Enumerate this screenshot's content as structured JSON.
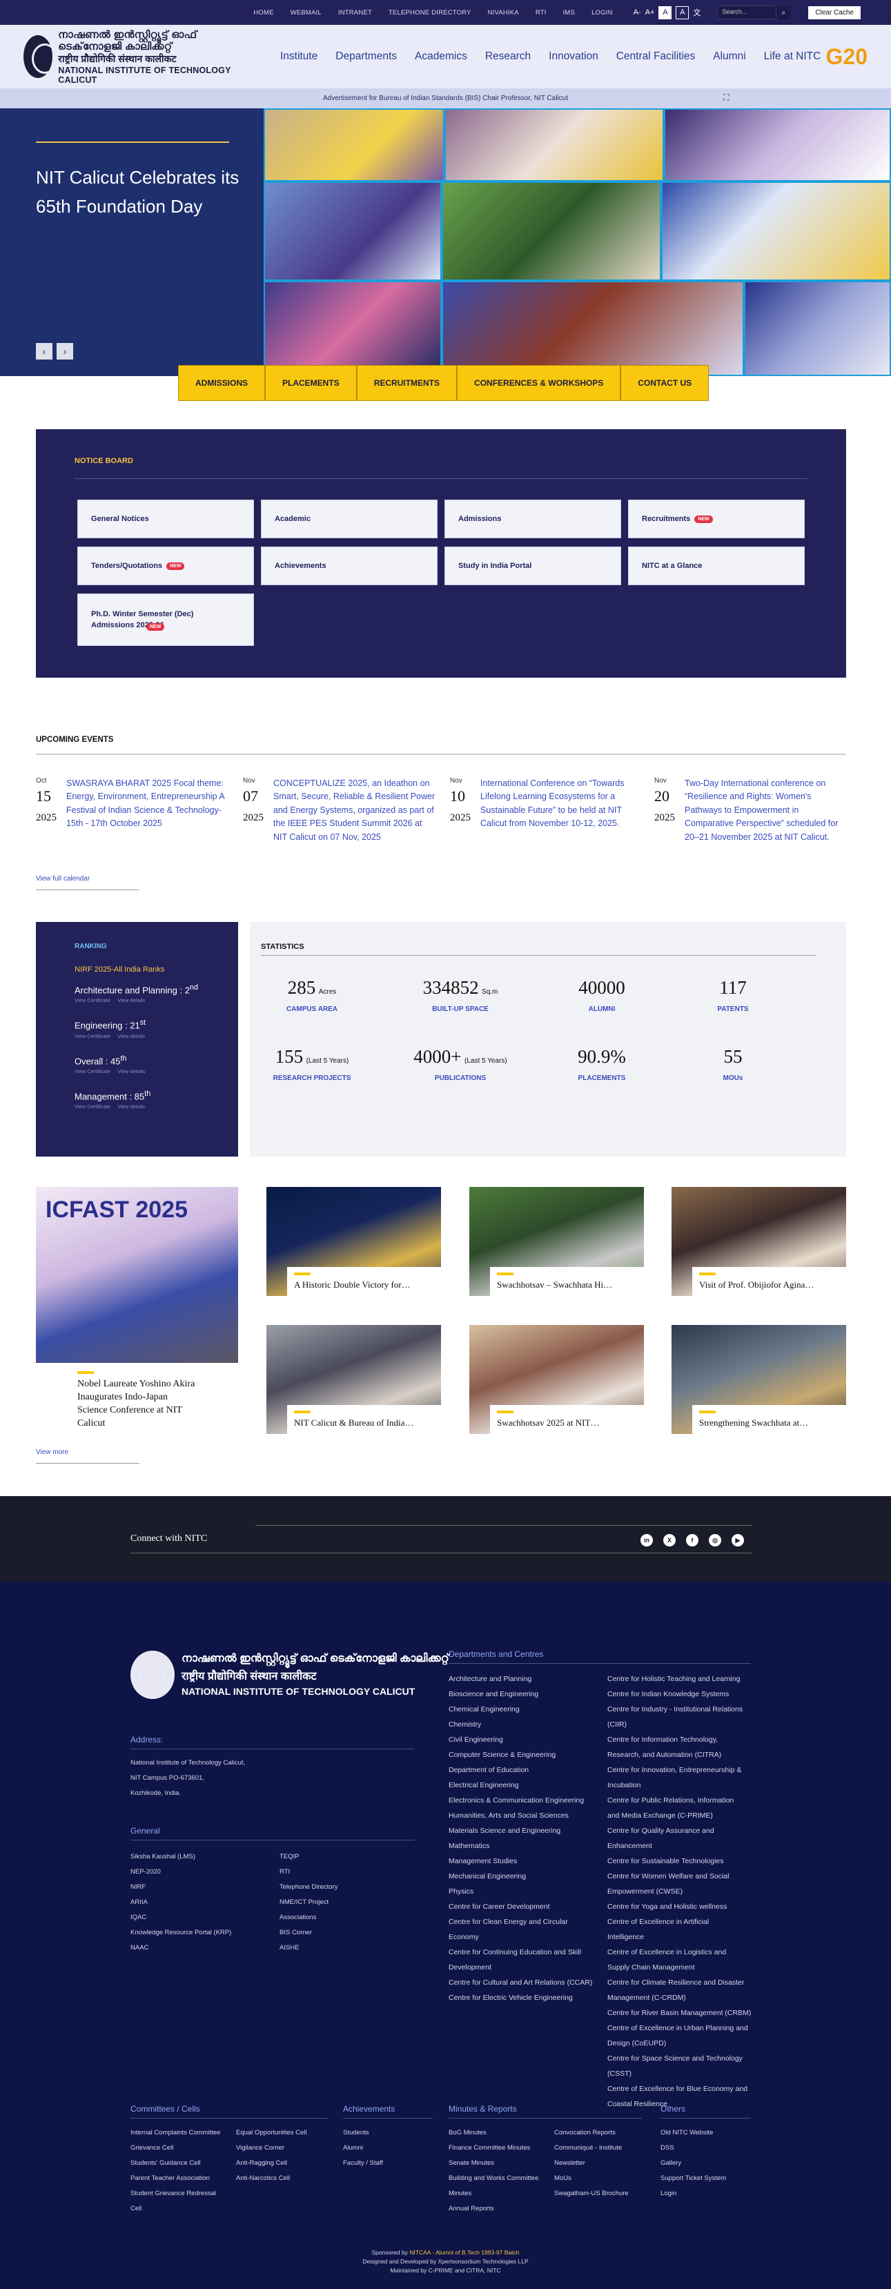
{
  "topbar": {
    "links": [
      "HOME",
      "WEBMAIL",
      "INTRANET",
      "TELEPHONE DIRECTORY",
      "NIVAHIKA",
      "RTI",
      "IMS",
      "LOGIN"
    ],
    "font_small": "A-",
    "font_large": "A+",
    "contrast_a": "A",
    "contrast_b": "A",
    "search_placeholder": "Search...",
    "clear_cache": "Clear Cache"
  },
  "header": {
    "logo_ml": "നാഷണൽ ഇൻസ്റ്റിറ്റ്യൂട്ട് ഓഫ് ടെക്‌നോളജി കാലിക്കറ്റ്",
    "logo_hi": "राष्ट्रीय प्रौद्योगिकी संस्थान कालीकट",
    "logo_en": "NATIONAL INSTITUTE OF TECHNOLOGY CALICUT",
    "nav": [
      "Institute",
      "Departments",
      "Academics",
      "Research",
      "Innovation",
      "Central Facilities",
      "Alumni",
      "Life at NITC"
    ],
    "g20": "G20"
  },
  "advt": "Advertisement for Bureau of Indian Standards (BIS) Chair Professor, NIT Calicut",
  "hero": {
    "title": "NIT Calicut Celebrates its 65th Foundation Day",
    "prev": "‹",
    "next": "›"
  },
  "quick": [
    "ADMISSIONS",
    "PLACEMENTS",
    "RECRUITMENTS",
    "CONFERENCES & WORKSHOPS",
    "CONTACT US"
  ],
  "notice": {
    "title": "NOTICE BOARD",
    "items": [
      {
        "label": "General Notices",
        "new": ""
      },
      {
        "label": "Academic",
        "new": ""
      },
      {
        "label": "Admissions",
        "new": ""
      },
      {
        "label": "Recruitments",
        "new": "NEW"
      },
      {
        "label": "Tenders/Quotations",
        "new": "NEW"
      },
      {
        "label": "Achievements",
        "new": ""
      },
      {
        "label": "Study in India Portal",
        "new": ""
      },
      {
        "label": "NITC at a Glance",
        "new": ""
      },
      {
        "label": "Ph.D. Winter Semester (Dec) Admissions 2025-26",
        "new": "NEW"
      }
    ]
  },
  "events": {
    "title": "UPCOMING EVENTS",
    "items": [
      {
        "m": "Oct",
        "d": "15",
        "y": "2025",
        "t": "SWASRAYA BHARAT 2025 Focal theme: Energy, Environment, Entrepreneurship A Festival of Indian Science & Technology-15th - 17th October 2025"
      },
      {
        "m": "Nov",
        "d": "07",
        "y": "2025",
        "t": "CONCEPTUALIZE 2025, an Ideathon on Smart, Secure, Reliable & Resilient Power and Energy Systems, organized as part of the IEEE PES Student Summit 2026 at NIT Calicut on 07 Nov, 2025"
      },
      {
        "m": "Nov",
        "d": "10",
        "y": "2025",
        "t": "International Conference on “Towards Lifelong Learning Ecosystems for a Sustainable Future” to be held at NIT Calicut from November 10-12, 2025."
      },
      {
        "m": "Nov",
        "d": "20",
        "y": "2025",
        "t": "Two-Day International conference on “Resilience and Rights: Women's Pathways to Empowerment in Comparative Perspective” scheduled for 20–21 November 2025 at NIT Calicut."
      }
    ],
    "view_all": "View full calendar"
  },
  "ranking": {
    "title": "RANKING",
    "nirf": "NIRF 2025-All India Ranks",
    "items": [
      {
        "label": "Architecture and Planning : 2",
        "sup": "nd"
      },
      {
        "label": "Engineering : 21",
        "sup": "st"
      },
      {
        "label": "Overall : 45",
        "sup": "th"
      },
      {
        "label": "Management : 85",
        "sup": "th"
      }
    ],
    "view_cert": "View Certificate",
    "view_details": "View details"
  },
  "stats": {
    "title": "STATISTICS",
    "items": [
      {
        "v": "285",
        "u": "Acres",
        "l": "CAMPUS AREA"
      },
      {
        "v": "334852",
        "u": "Sq.m",
        "l": "BUILT-UP SPACE"
      },
      {
        "v": "40000",
        "u": "",
        "l": "ALUMNI"
      },
      {
        "v": "117",
        "u": "",
        "l": "PATENTS"
      },
      {
        "v": "155",
        "u": "(Last 5 Years)",
        "l": "RESEARCH PROJECTS"
      },
      {
        "v": "4000+",
        "u": "(Last 5 Years)",
        "l": "PUBLICATIONS"
      },
      {
        "v": "90.9%",
        "u": "",
        "l": "PLACEMENTS"
      },
      {
        "v": "55",
        "u": "",
        "l": "MOUs"
      }
    ]
  },
  "news": {
    "feature": "Nobel Laureate Yoshino Akira Inaugurates Indo-Japan Science Conference at NIT Calicut",
    "feature_banner": "ICFAST 2025",
    "items": [
      "A Historic Double Victory for…",
      "Swachhotsav – Swachhata Hi…",
      "Visit of Prof. Obijiofor Agina…",
      "NIT Calicut & Bureau of India…",
      "Swachhotsav 2025 at NIT…",
      "Strengthening Swachhata at…"
    ],
    "view_more": "View more"
  },
  "connect": {
    "title": "Connect with NITC",
    "social": [
      "in",
      "X",
      "f",
      "◎",
      "▶"
    ]
  },
  "footer": {
    "address_title": "Address:",
    "address": [
      "National Institute of Technology Calicut,",
      "NIT Campus PO-673601,",
      "Kozhikode, India."
    ],
    "general_title": "General",
    "general_a": [
      "Siksha Kaushal (LMS)",
      "NEP-2020",
      "NIRF",
      "ARIIA",
      "IQAC",
      "Knowledge Resource Portal (KRP)",
      "NAAC"
    ],
    "general_b": [
      "TEQIP",
      "RTI",
      "Telephone Directory",
      "NME/ICT Project",
      "Associations",
      "BIS Corner",
      "AISHE"
    ],
    "dept_title": "Departments and Centres",
    "dept_a": [
      "Architecture and Planning",
      "Bioscience and Engineering",
      "Chemical Engineering",
      "Chemistry",
      "Civil Engineering",
      "Computer Science & Engineering",
      "Department of Education",
      "Electrical Engineering",
      "Electronics & Communication Engineering",
      "Humanities, Arts and Social Sciences",
      "Materials Science and Engineering",
      "Mathematics",
      "Management Studies",
      "Mechanical Engineering",
      "Physics",
      "Centre for Career Development",
      "Centre for Clean Energy and Circular",
      "Economy",
      "Centre for Continuing Education and Skill",
      "Development",
      "Centre for Cultural and Art Relations (CCAR)",
      "Centre for Electric Vehicle Engineering"
    ],
    "dept_b": [
      "Centre for Holistic Teaching and Learning",
      "Centre for Indian Knowledge Systems",
      "Centre for Industry - Institutional Relations",
      "(CIIR)",
      "Centre for Information Technology,",
      "Research, and Automation (CITRA)",
      "Centre for Innovation, Entrepreneurship &",
      "Incubation",
      "Centre for Public Relations, Information",
      "and Media Exchange (C-PRIME)",
      "Centre for Quality Assurance and",
      "Enhancement",
      "Centre for Sustainable Technologies",
      "Centre for Women Welfare and Social",
      "Empowerment (CWSE)",
      "Centre for Yoga and Holistic wellness",
      "Centre of Excellence in Artificial",
      "Intelligence",
      "Centre of Excellence in Logistics and",
      "Supply Chain Management",
      "Centre for Climate Resilience and Disaster",
      "Management (C-CRDM)",
      "Centre for River Basin Management (CRBM)",
      "Centre of Excellence in Urban Planning and",
      "Design (CoEUPD)",
      "Centre for Space Science and Technology",
      "(CSST)",
      "Centre of Excellence for Blue Economy and",
      "Coastal Resilience"
    ],
    "committees_title": "Committees / Cells",
    "committees_a": [
      "Internal Complaints Committee",
      "Grievance Cell",
      "Students' Guidance Cell",
      "Parent Teacher Association",
      "Student Grievance Redressal",
      "Cell"
    ],
    "committees_b": [
      "Equal Opportunities Cell",
      "Vigilance Corner",
      "Anti-Ragging Cell",
      "Anti-Narcotics Cell"
    ],
    "achievements_title": "Achievements",
    "achievements": [
      "Students",
      "Alumni",
      "Faculty / Staff"
    ],
    "minutes_title": "Minutes & Reports",
    "minutes_a": [
      "BoG Minutes",
      "Finance Committee Minutes",
      "Senate Minutes",
      "Building and Works Committee",
      "Minutes",
      "Annual Reports"
    ],
    "minutes_b": [
      "Convocation Reports",
      "Communiqué - Institute",
      "Newsletter",
      "MoUs",
      "Swagatham-US Brochure"
    ],
    "others_title": "Others",
    "others": [
      "Old NITC Website",
      "DSS",
      "Gallery",
      "Support Ticket System",
      "Login"
    ],
    "sponsor_prefix": "Sponsored by ",
    "sponsor": "NITCAA - Alumni of B.Tech 1993-97 Batch",
    "designed": "Designed and Developed by Xpertsonsortium Technologies LLP",
    "maintained": "Maintained by C-PRIME and CITRA, NITC"
  }
}
